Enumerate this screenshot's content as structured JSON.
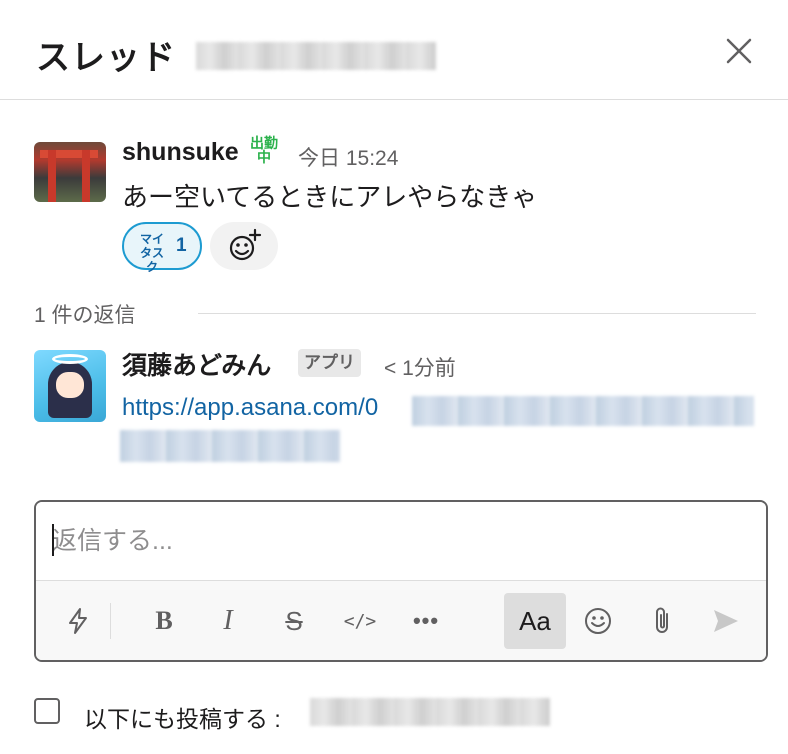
{
  "header": {
    "title": "スレッド"
  },
  "parent_message": {
    "author": "shunsuke",
    "status_badge": "出勤中",
    "timestamp": "今日 15:24",
    "text": "あー空いてるときにアレやらなきゃ",
    "reaction": {
      "emoji_label": "マイタスク",
      "count": "1"
    }
  },
  "replies": {
    "label": "1 件の返信",
    "items": [
      {
        "author": "須藤あどみん",
        "badge": "アプリ",
        "timestamp": "< 1分前",
        "link_text": "https://app.asana.com/0"
      }
    ]
  },
  "composer": {
    "placeholder": "返信する...",
    "value": "",
    "format_text_label": "Aa"
  },
  "footer": {
    "also_post_label": "以下にも投稿する :",
    "also_post_checked": false
  },
  "colors": {
    "accent": "#1264a3",
    "reaction_border": "#1d9bd1",
    "status_green": "#2bb24c"
  },
  "icons": [
    "close-icon",
    "add-reaction-icon",
    "shortcuts-icon",
    "bold-icon",
    "italic-icon",
    "strikethrough-icon",
    "code-icon",
    "more-icon",
    "emoji-icon",
    "attachment-icon",
    "send-icon"
  ]
}
